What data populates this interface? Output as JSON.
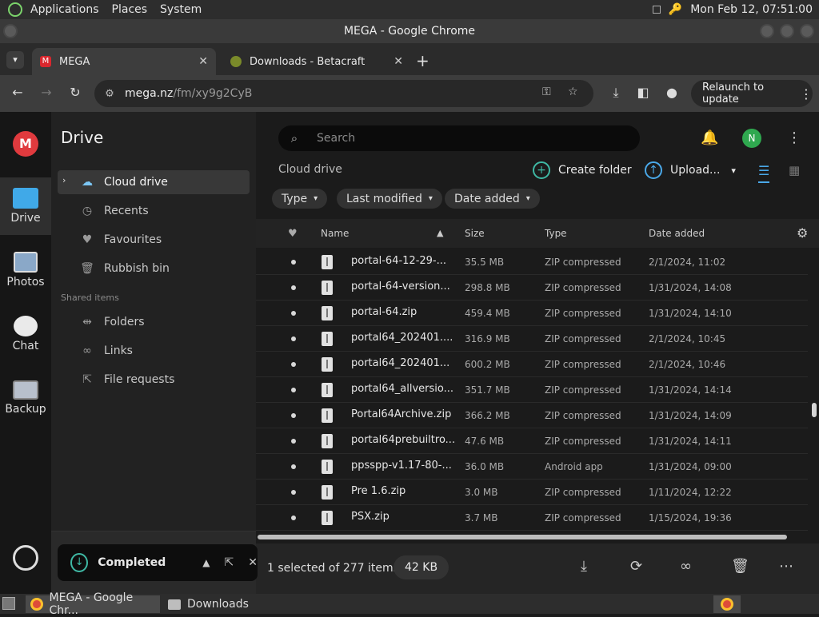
{
  "os": {
    "menu": [
      "Applications",
      "Places",
      "System"
    ],
    "clock": "Mon Feb 12, 07:51:00"
  },
  "window": {
    "title": "MEGA - Google Chrome"
  },
  "tabs": [
    {
      "label": "MEGA",
      "close": "✕"
    },
    {
      "label": "Downloads - Betacraft",
      "close": "✕"
    }
  ],
  "new_tab": "+",
  "address": {
    "host": "mega.nz",
    "path": "/fm/xy9g2CyB"
  },
  "relaunch": {
    "label": "Relaunch to update",
    "more": "⋮"
  },
  "rail": [
    {
      "label": "Drive"
    },
    {
      "label": "Photos"
    },
    {
      "label": "Chat"
    },
    {
      "label": "Backup"
    }
  ],
  "sidebar": {
    "title": "Drive",
    "items": [
      {
        "label": "Cloud drive",
        "icon": "cloud-icon"
      },
      {
        "label": "Recents",
        "icon": "clock-icon"
      },
      {
        "label": "Favourites",
        "icon": "heart-icon"
      },
      {
        "label": "Rubbish bin",
        "icon": "trash-icon"
      }
    ],
    "shared_header": "Shared items",
    "shared": [
      {
        "label": "Folders",
        "icon": "shared-folder-icon"
      },
      {
        "label": "Links",
        "icon": "link-icon"
      },
      {
        "label": "File requests",
        "icon": "file-request-icon"
      }
    ]
  },
  "main": {
    "search_placeholder": "Search",
    "avatar_letter": "N",
    "breadcrumb": "Cloud drive",
    "create_folder": "Create folder",
    "upload": "Upload...",
    "filters": [
      "Type",
      "Last modified",
      "Date added"
    ],
    "columns": {
      "name": "Name",
      "size": "Size",
      "type": "Type",
      "date": "Date added"
    },
    "rows": [
      {
        "name": "portal-64-12-29-...",
        "size": "35.5 MB",
        "type": "ZIP compressed",
        "date": "2/1/2024, 11:02"
      },
      {
        "name": "portal-64-version...",
        "size": "298.8 MB",
        "type": "ZIP compressed",
        "date": "1/31/2024, 14:08"
      },
      {
        "name": "portal-64.zip",
        "size": "459.4 MB",
        "type": "ZIP compressed",
        "date": "1/31/2024, 14:10"
      },
      {
        "name": "portal64_202401....",
        "size": "316.9 MB",
        "type": "ZIP compressed",
        "date": "2/1/2024, 10:45"
      },
      {
        "name": "portal64_202401...",
        "size": "600.2 MB",
        "type": "ZIP compressed",
        "date": "2/1/2024, 10:46"
      },
      {
        "name": "portal64_allversio...",
        "size": "351.7 MB",
        "type": "ZIP compressed",
        "date": "1/31/2024, 14:14"
      },
      {
        "name": "Portal64Archive.zip",
        "size": "366.2 MB",
        "type": "ZIP compressed",
        "date": "1/31/2024, 14:09"
      },
      {
        "name": "portal64prebuiltro...",
        "size": "47.6 MB",
        "type": "ZIP compressed",
        "date": "1/31/2024, 14:11"
      },
      {
        "name": "ppsspp-v1.17-80-...",
        "size": "36.0 MB",
        "type": "Android app",
        "date": "1/31/2024, 09:00"
      },
      {
        "name": "Pre 1.6.zip",
        "size": "3.0 MB",
        "type": "ZIP compressed",
        "date": "1/11/2024, 12:22"
      },
      {
        "name": "PSX.zip",
        "size": "3.7 MB",
        "type": "ZIP compressed",
        "date": "1/15/2024, 19:36"
      }
    ],
    "selection": "1 selected of 277 items",
    "selection_size": "42 KB"
  },
  "toast": {
    "label": "Completed"
  },
  "taskbar": [
    {
      "label": "MEGA - Google Chr..."
    },
    {
      "label": "Downloads"
    }
  ]
}
